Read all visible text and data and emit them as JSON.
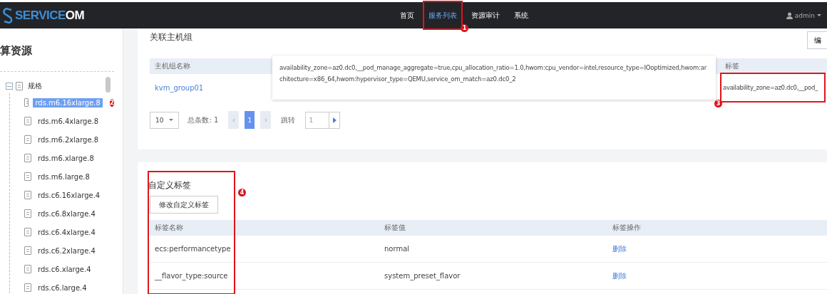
{
  "header": {
    "logo": "SERVICEOM",
    "nav": [
      {
        "label": "首页",
        "selected": false
      },
      {
        "label": "服务列表",
        "selected": true,
        "callout": "1"
      },
      {
        "label": "资源审计",
        "selected": false
      },
      {
        "label": "系统",
        "selected": false
      }
    ],
    "user": "admin"
  },
  "sidebar": {
    "title": "算资源",
    "tree": [
      {
        "label": "规格",
        "expanded": true,
        "children": [
          {
            "label": "rds.m6.16xlarge.8",
            "selected": true,
            "callout": "2"
          },
          {
            "label": "rds.m6.4xlarge.8",
            "selected": false
          },
          {
            "label": "rds.m6.2xlarge.8",
            "selected": false
          },
          {
            "label": "rds.m6.xlarge.8",
            "selected": false
          },
          {
            "label": "rds.m6.large.8",
            "selected": false
          },
          {
            "label": "rds.c6.16xlarge.4",
            "selected": false
          },
          {
            "label": "rds.c6.8xlarge.4",
            "selected": false
          },
          {
            "label": "rds.c6.4xlarge.4",
            "selected": false
          },
          {
            "label": "rds.c6.2xlarge.4",
            "selected": false
          },
          {
            "label": "rds.c6.xlarge.4",
            "selected": false
          },
          {
            "label": "rds.c6.large.4",
            "selected": false
          }
        ]
      }
    ]
  },
  "host_group_card": {
    "title": "关联主机组",
    "edit_button": "编",
    "columns": [
      "主机组名称",
      "标签"
    ],
    "rows": [
      {
        "name": "kvm_group01",
        "tag": "availability_zone=az0.dc0,__pod_",
        "tag_callout": "3"
      }
    ],
    "tooltip": "availability_zone=az0.dc0,__pod_manage_aggregate=true,cpu_allocation_ratio=1.0,hwom:cpu_vendor=intel,resource_type=IOoptimized,hwom:architecture=x86_64,hwom:hypervisor_type=QEMU,service_om_match=az0.dc0_2",
    "pagination": {
      "page_size": "10",
      "total": "总条数: 1",
      "prev": "‹",
      "next": "›",
      "pages": [
        {
          "label": "1",
          "selected": true
        }
      ],
      "jump_label": "跳转",
      "jump_value": "1"
    }
  },
  "custom_tags_card": {
    "title": "自定义标签",
    "button": "修改自定义标签",
    "callout": "4",
    "columns": [
      "标签名称",
      "标签值",
      "标签操作"
    ],
    "rows": [
      {
        "name": "ecs:performancetype",
        "value": "normal",
        "action": "删除"
      },
      {
        "name": "__flavor_type:source",
        "value": "system_preset_flavor",
        "action": "删除"
      }
    ]
  }
}
